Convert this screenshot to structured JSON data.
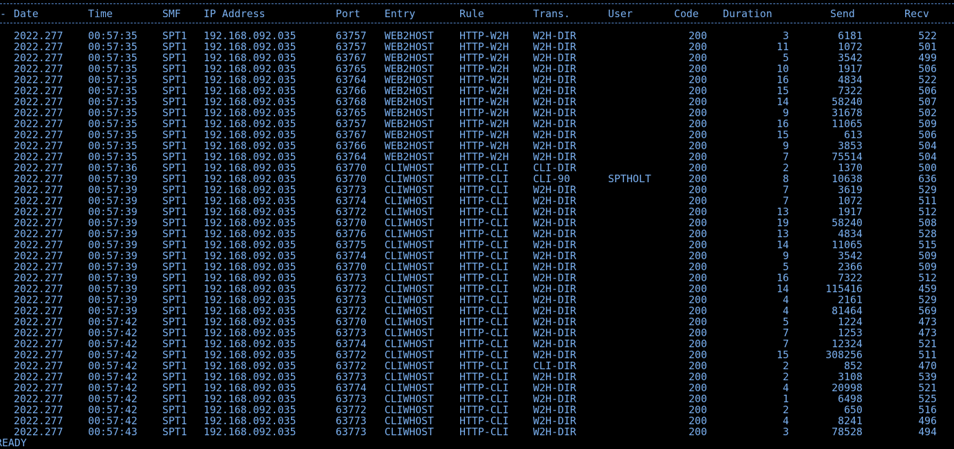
{
  "header": {
    "arrow": "-",
    "date": "Date",
    "time": "Time",
    "smf": "SMF",
    "ip": "IP Address",
    "port": "Port",
    "entry": "Entry",
    "rule": "Rule",
    "trans": "Trans.",
    "user": "User",
    "code": "Code",
    "duration": "Duration",
    "send": "Send",
    "recv": "Recv"
  },
  "rows": [
    {
      "date": "2022.277",
      "time": "00:57:35",
      "smf": "SPT1",
      "ip": "192.168.092.035",
      "port": "63757",
      "entry": "WEB2HOST",
      "rule": "HTTP-W2H",
      "trans": "W2H-DIR",
      "user": "",
      "code": "200",
      "duration": "3",
      "send": "6181",
      "recv": "522"
    },
    {
      "date": "2022.277",
      "time": "00:57:35",
      "smf": "SPT1",
      "ip": "192.168.092.035",
      "port": "63757",
      "entry": "WEB2HOST",
      "rule": "HTTP-W2H",
      "trans": "W2H-DIR",
      "user": "",
      "code": "200",
      "duration": "11",
      "send": "1072",
      "recv": "501"
    },
    {
      "date": "2022.277",
      "time": "00:57:35",
      "smf": "SPT1",
      "ip": "192.168.092.035",
      "port": "63767",
      "entry": "WEB2HOST",
      "rule": "HTTP-W2H",
      "trans": "W2H-DIR",
      "user": "",
      "code": "200",
      "duration": "5",
      "send": "3542",
      "recv": "499"
    },
    {
      "date": "2022.277",
      "time": "00:57:35",
      "smf": "SPT1",
      "ip": "192.168.092.035",
      "port": "63765",
      "entry": "WEB2HOST",
      "rule": "HTTP-W2H",
      "trans": "W2H-DIR",
      "user": "",
      "code": "200",
      "duration": "10",
      "send": "1917",
      "recv": "506"
    },
    {
      "date": "2022.277",
      "time": "00:57:35",
      "smf": "SPT1",
      "ip": "192.168.092.035",
      "port": "63764",
      "entry": "WEB2HOST",
      "rule": "HTTP-W2H",
      "trans": "W2H-DIR",
      "user": "",
      "code": "200",
      "duration": "16",
      "send": "4834",
      "recv": "522"
    },
    {
      "date": "2022.277",
      "time": "00:57:35",
      "smf": "SPT1",
      "ip": "192.168.092.035",
      "port": "63766",
      "entry": "WEB2HOST",
      "rule": "HTTP-W2H",
      "trans": "W2H-DIR",
      "user": "",
      "code": "200",
      "duration": "15",
      "send": "7322",
      "recv": "506"
    },
    {
      "date": "2022.277",
      "time": "00:57:35",
      "smf": "SPT1",
      "ip": "192.168.092.035",
      "port": "63768",
      "entry": "WEB2HOST",
      "rule": "HTTP-W2H",
      "trans": "W2H-DIR",
      "user": "",
      "code": "200",
      "duration": "14",
      "send": "58240",
      "recv": "507"
    },
    {
      "date": "2022.277",
      "time": "00:57:35",
      "smf": "SPT1",
      "ip": "192.168.092.035",
      "port": "63765",
      "entry": "WEB2HOST",
      "rule": "HTTP-W2H",
      "trans": "W2H-DIR",
      "user": "",
      "code": "200",
      "duration": "9",
      "send": "31678",
      "recv": "502"
    },
    {
      "date": "2022.277",
      "time": "00:57:35",
      "smf": "SPT1",
      "ip": "192.168.092.035",
      "port": "63757",
      "entry": "WEB2HOST",
      "rule": "HTTP-W2H",
      "trans": "W2H-DIR",
      "user": "",
      "code": "200",
      "duration": "16",
      "send": "11065",
      "recv": "509"
    },
    {
      "date": "2022.277",
      "time": "00:57:35",
      "smf": "SPT1",
      "ip": "192.168.092.035",
      "port": "63767",
      "entry": "WEB2HOST",
      "rule": "HTTP-W2H",
      "trans": "W2H-DIR",
      "user": "",
      "code": "200",
      "duration": "15",
      "send": "613",
      "recv": "506"
    },
    {
      "date": "2022.277",
      "time": "00:57:35",
      "smf": "SPT1",
      "ip": "192.168.092.035",
      "port": "63766",
      "entry": "WEB2HOST",
      "rule": "HTTP-W2H",
      "trans": "W2H-DIR",
      "user": "",
      "code": "200",
      "duration": "9",
      "send": "3853",
      "recv": "504"
    },
    {
      "date": "2022.277",
      "time": "00:57:35",
      "smf": "SPT1",
      "ip": "192.168.092.035",
      "port": "63764",
      "entry": "WEB2HOST",
      "rule": "HTTP-W2H",
      "trans": "W2H-DIR",
      "user": "",
      "code": "200",
      "duration": "7",
      "send": "75514",
      "recv": "504"
    },
    {
      "date": "2022.277",
      "time": "00:57:36",
      "smf": "SPT1",
      "ip": "192.168.092.035",
      "port": "63770",
      "entry": "CLIWHOST",
      "rule": "HTTP-CLI",
      "trans": "CLI-DIR",
      "user": "",
      "code": "200",
      "duration": "2",
      "send": "1370",
      "recv": "500"
    },
    {
      "date": "2022.277",
      "time": "00:57:39",
      "smf": "SPT1",
      "ip": "192.168.092.035",
      "port": "63770",
      "entry": "CLIWHOST",
      "rule": "HTTP-CLI",
      "trans": "CLI-90",
      "user": "SPTHOLT",
      "code": "200",
      "duration": "8",
      "send": "10638",
      "recv": "636"
    },
    {
      "date": "2022.277",
      "time": "00:57:39",
      "smf": "SPT1",
      "ip": "192.168.092.035",
      "port": "63773",
      "entry": "CLIWHOST",
      "rule": "HTTP-CLI",
      "trans": "W2H-DIR",
      "user": "",
      "code": "200",
      "duration": "7",
      "send": "3619",
      "recv": "529"
    },
    {
      "date": "2022.277",
      "time": "00:57:39",
      "smf": "SPT1",
      "ip": "192.168.092.035",
      "port": "63774",
      "entry": "CLIWHOST",
      "rule": "HTTP-CLI",
      "trans": "W2H-DIR",
      "user": "",
      "code": "200",
      "duration": "7",
      "send": "1072",
      "recv": "511"
    },
    {
      "date": "2022.277",
      "time": "00:57:39",
      "smf": "SPT1",
      "ip": "192.168.092.035",
      "port": "63772",
      "entry": "CLIWHOST",
      "rule": "HTTP-CLI",
      "trans": "W2H-DIR",
      "user": "",
      "code": "200",
      "duration": "13",
      "send": "1917",
      "recv": "512"
    },
    {
      "date": "2022.277",
      "time": "00:57:39",
      "smf": "SPT1",
      "ip": "192.168.092.035",
      "port": "63770",
      "entry": "CLIWHOST",
      "rule": "HTTP-CLI",
      "trans": "W2H-DIR",
      "user": "",
      "code": "200",
      "duration": "19",
      "send": "58240",
      "recv": "508"
    },
    {
      "date": "2022.277",
      "time": "00:57:39",
      "smf": "SPT1",
      "ip": "192.168.092.035",
      "port": "63776",
      "entry": "CLIWHOST",
      "rule": "HTTP-CLI",
      "trans": "W2H-DIR",
      "user": "",
      "code": "200",
      "duration": "13",
      "send": "4834",
      "recv": "528"
    },
    {
      "date": "2022.277",
      "time": "00:57:39",
      "smf": "SPT1",
      "ip": "192.168.092.035",
      "port": "63775",
      "entry": "CLIWHOST",
      "rule": "HTTP-CLI",
      "trans": "W2H-DIR",
      "user": "",
      "code": "200",
      "duration": "14",
      "send": "11065",
      "recv": "515"
    },
    {
      "date": "2022.277",
      "time": "00:57:39",
      "smf": "SPT1",
      "ip": "192.168.092.035",
      "port": "63774",
      "entry": "CLIWHOST",
      "rule": "HTTP-CLI",
      "trans": "W2H-DIR",
      "user": "",
      "code": "200",
      "duration": "9",
      "send": "3542",
      "recv": "509"
    },
    {
      "date": "2022.277",
      "time": "00:57:39",
      "smf": "SPT1",
      "ip": "192.168.092.035",
      "port": "63770",
      "entry": "CLIWHOST",
      "rule": "HTTP-CLI",
      "trans": "W2H-DIR",
      "user": "",
      "code": "200",
      "duration": "5",
      "send": "2366",
      "recv": "509"
    },
    {
      "date": "2022.277",
      "time": "00:57:39",
      "smf": "SPT1",
      "ip": "192.168.092.035",
      "port": "63773",
      "entry": "CLIWHOST",
      "rule": "HTTP-CLI",
      "trans": "W2H-DIR",
      "user": "",
      "code": "200",
      "duration": "16",
      "send": "7322",
      "recv": "512"
    },
    {
      "date": "2022.277",
      "time": "00:57:39",
      "smf": "SPT1",
      "ip": "192.168.092.035",
      "port": "63772",
      "entry": "CLIWHOST",
      "rule": "HTTP-CLI",
      "trans": "W2H-DIR",
      "user": "",
      "code": "200",
      "duration": "14",
      "send": "115416",
      "recv": "459"
    },
    {
      "date": "2022.277",
      "time": "00:57:39",
      "smf": "SPT1",
      "ip": "192.168.092.035",
      "port": "63773",
      "entry": "CLIWHOST",
      "rule": "HTTP-CLI",
      "trans": "W2H-DIR",
      "user": "",
      "code": "200",
      "duration": "4",
      "send": "2161",
      "recv": "529"
    },
    {
      "date": "2022.277",
      "time": "00:57:39",
      "smf": "SPT1",
      "ip": "192.168.092.035",
      "port": "63772",
      "entry": "CLIWHOST",
      "rule": "HTTP-CLI",
      "trans": "W2H-DIR",
      "user": "",
      "code": "200",
      "duration": "4",
      "send": "81464",
      "recv": "569"
    },
    {
      "date": "2022.277",
      "time": "00:57:42",
      "smf": "SPT1",
      "ip": "192.168.092.035",
      "port": "63770",
      "entry": "CLIWHOST",
      "rule": "HTTP-CLI",
      "trans": "W2H-DIR",
      "user": "",
      "code": "200",
      "duration": "5",
      "send": "1224",
      "recv": "473"
    },
    {
      "date": "2022.277",
      "time": "00:57:42",
      "smf": "SPT1",
      "ip": "192.168.092.035",
      "port": "63773",
      "entry": "CLIWHOST",
      "rule": "HTTP-CLI",
      "trans": "W2H-DIR",
      "user": "",
      "code": "200",
      "duration": "7",
      "send": "1253",
      "recv": "473"
    },
    {
      "date": "2022.277",
      "time": "00:57:42",
      "smf": "SPT1",
      "ip": "192.168.092.035",
      "port": "63774",
      "entry": "CLIWHOST",
      "rule": "HTTP-CLI",
      "trans": "W2H-DIR",
      "user": "",
      "code": "200",
      "duration": "7",
      "send": "12324",
      "recv": "521"
    },
    {
      "date": "2022.277",
      "time": "00:57:42",
      "smf": "SPT1",
      "ip": "192.168.092.035",
      "port": "63772",
      "entry": "CLIWHOST",
      "rule": "HTTP-CLI",
      "trans": "W2H-DIR",
      "user": "",
      "code": "200",
      "duration": "15",
      "send": "308256",
      "recv": "511"
    },
    {
      "date": "2022.277",
      "time": "00:57:42",
      "smf": "SPT1",
      "ip": "192.168.092.035",
      "port": "63772",
      "entry": "CLIWHOST",
      "rule": "HTTP-CLI",
      "trans": "CLI-DIR",
      "user": "",
      "code": "200",
      "duration": "2",
      "send": "852",
      "recv": "470"
    },
    {
      "date": "2022.277",
      "time": "00:57:42",
      "smf": "SPT1",
      "ip": "192.168.092.035",
      "port": "63773",
      "entry": "CLIWHOST",
      "rule": "HTTP-CLI",
      "trans": "W2H-DIR",
      "user": "",
      "code": "200",
      "duration": "2",
      "send": "3108",
      "recv": "539"
    },
    {
      "date": "2022.277",
      "time": "00:57:42",
      "smf": "SPT1",
      "ip": "192.168.092.035",
      "port": "63774",
      "entry": "CLIWHOST",
      "rule": "HTTP-CLI",
      "trans": "W2H-DIR",
      "user": "",
      "code": "200",
      "duration": "4",
      "send": "20998",
      "recv": "521"
    },
    {
      "date": "2022.277",
      "time": "00:57:42",
      "smf": "SPT1",
      "ip": "192.168.092.035",
      "port": "63773",
      "entry": "CLIWHOST",
      "rule": "HTTP-CLI",
      "trans": "W2H-DIR",
      "user": "",
      "code": "200",
      "duration": "1",
      "send": "6498",
      "recv": "525"
    },
    {
      "date": "2022.277",
      "time": "00:57:42",
      "smf": "SPT1",
      "ip": "192.168.092.035",
      "port": "63772",
      "entry": "CLIWHOST",
      "rule": "HTTP-CLI",
      "trans": "W2H-DIR",
      "user": "",
      "code": "200",
      "duration": "2",
      "send": "650",
      "recv": "516"
    },
    {
      "date": "2022.277",
      "time": "00:57:42",
      "smf": "SPT1",
      "ip": "192.168.092.035",
      "port": "63773",
      "entry": "CLIWHOST",
      "rule": "HTTP-CLI",
      "trans": "W2H-DIR",
      "user": "",
      "code": "200",
      "duration": "4",
      "send": "8241",
      "recv": "496"
    },
    {
      "date": "2022.277",
      "time": "00:57:43",
      "smf": "SPT1",
      "ip": "192.168.092.035",
      "port": "63773",
      "entry": "CLIWHOST",
      "rule": "HTTP-CLI",
      "trans": "W2H-DIR",
      "user": "",
      "code": "200",
      "duration": "3",
      "send": "78528",
      "recv": "494"
    }
  ],
  "status": "READY",
  "colors": {
    "background": "#000000",
    "text": "#7ab0f0"
  }
}
